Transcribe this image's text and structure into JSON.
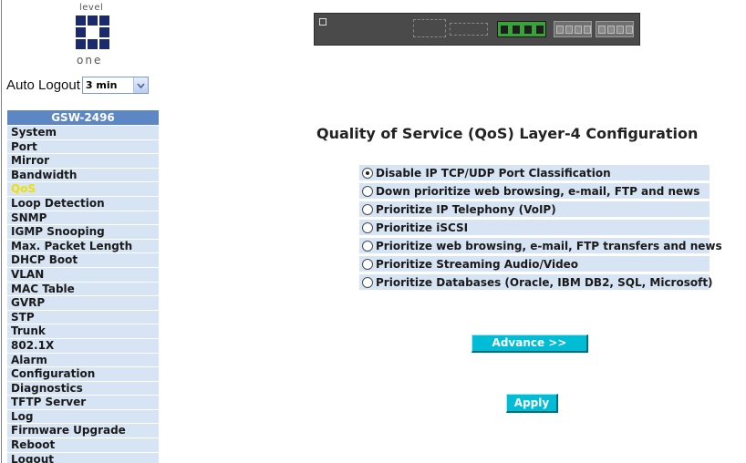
{
  "logo": {
    "top_text": "level",
    "bottom_text": "one"
  },
  "auto_logout": {
    "label": "Auto Logout",
    "selected": "3 min"
  },
  "menu": {
    "title": "GSW-2496",
    "items": [
      {
        "label": "System"
      },
      {
        "label": "Port"
      },
      {
        "label": "Mirror"
      },
      {
        "label": "Bandwidth"
      },
      {
        "label": "QoS"
      },
      {
        "label": "Loop Detection"
      },
      {
        "label": "SNMP"
      },
      {
        "label": "IGMP Snooping"
      },
      {
        "label": "Max. Packet Length"
      },
      {
        "label": "DHCP Boot"
      },
      {
        "label": "VLAN"
      },
      {
        "label": "MAC Table"
      },
      {
        "label": "GVRP"
      },
      {
        "label": "STP"
      },
      {
        "label": "Trunk"
      },
      {
        "label": "802.1X"
      },
      {
        "label": "Alarm"
      },
      {
        "label": "Configuration"
      },
      {
        "label": "Diagnostics"
      },
      {
        "label": "TFTP Server"
      },
      {
        "label": "Log"
      },
      {
        "label": "Firmware Upgrade"
      },
      {
        "label": "Reboot"
      },
      {
        "label": "Logout"
      }
    ],
    "active_label": "QoS",
    "active_color": "#f0e000"
  },
  "main": {
    "title": "Quality of Service (QoS) Layer-4 Configuration",
    "options": [
      {
        "label": "Disable IP TCP/UDP Port Classification",
        "checked": true
      },
      {
        "label": "Down prioritize web browsing, e-mail, FTP and news",
        "checked": false
      },
      {
        "label": "Prioritize IP Telephony (VoIP)",
        "checked": false
      },
      {
        "label": "Prioritize iSCSI",
        "checked": false
      },
      {
        "label": "Prioritize web browsing, e-mail, FTP transfers and news",
        "checked": false
      },
      {
        "label": "Prioritize Streaming Audio/Video",
        "checked": false
      },
      {
        "label": "Prioritize Databases (Oracle, IBM DB2, SQL, Microsoft)",
        "checked": false
      }
    ],
    "advance_label": "Advance >>",
    "apply_label": "Apply"
  },
  "colors": {
    "menu_header": "#5d87c4",
    "row_background": "#d6e4f3",
    "button": "#00bcd4"
  }
}
